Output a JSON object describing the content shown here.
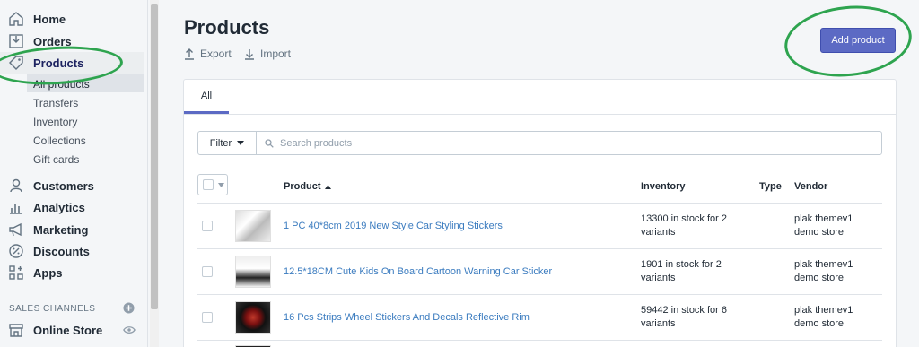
{
  "sidebar": {
    "items": [
      {
        "label": "Home",
        "icon": "home-icon"
      },
      {
        "label": "Orders",
        "icon": "orders-icon"
      },
      {
        "label": "Products",
        "icon": "tag-icon"
      },
      {
        "label": "Customers",
        "icon": "person-icon"
      },
      {
        "label": "Analytics",
        "icon": "bar-chart-icon"
      },
      {
        "label": "Marketing",
        "icon": "megaphone-icon"
      },
      {
        "label": "Discounts",
        "icon": "discount-icon"
      },
      {
        "label": "Apps",
        "icon": "apps-icon"
      }
    ],
    "products_sub": [
      "All products",
      "Transfers",
      "Inventory",
      "Collections",
      "Gift cards"
    ],
    "sales_channels_title": "SALES CHANNELS",
    "online_store": "Online Store"
  },
  "header": {
    "title": "Products",
    "export_label": "Export",
    "import_label": "Import",
    "add_product_label": "Add product"
  },
  "tabs": [
    {
      "label": "All"
    }
  ],
  "filter": {
    "label": "Filter",
    "search_placeholder": "Search products"
  },
  "table": {
    "columns": {
      "product": "Product",
      "inventory": "Inventory",
      "type": "Type",
      "vendor": "Vendor"
    },
    "rows": [
      {
        "product": "1 PC 40*8cm 2019 New Style Car Styling Stickers",
        "inv1": "13300 in stock for 2",
        "inv2": "variants",
        "vendor1": "plak themev1",
        "vendor2": "demo store"
      },
      {
        "product": "12.5*18CM Cute Kids On Board Cartoon Warning Car Sticker",
        "inv1": "1901 in stock for 2",
        "inv2": "variants",
        "vendor1": "plak themev1",
        "vendor2": "demo store"
      },
      {
        "product": "16 Pcs Strips Wheel Stickers And Decals Reflective Rim",
        "inv1": "59442 in stock for 6",
        "inv2": "variants",
        "vendor1": "plak themev1",
        "vendor2": "demo store"
      }
    ]
  },
  "colors": {
    "primary": "#5c6ac4",
    "link": "#3a7bbf",
    "annotation": "#2ea44f"
  }
}
